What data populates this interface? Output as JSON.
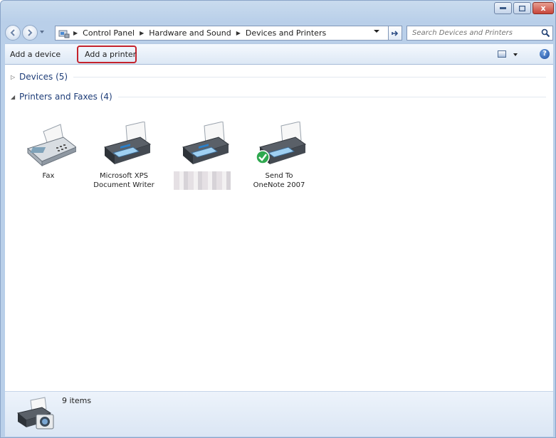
{
  "window": {
    "caption": {
      "minimize_symbol": "–",
      "maximize_symbol": "□",
      "close_symbol": "x"
    }
  },
  "address_bar": {
    "breadcrumbs": [
      "Control Panel",
      "Hardware and Sound",
      "Devices and Printers"
    ]
  },
  "search": {
    "placeholder": "Search Devices and Printers"
  },
  "toolbar": {
    "add_device_label": "Add a device",
    "add_printer_label": "Add a printer",
    "highlight_color": "#c4222c"
  },
  "groups": {
    "devices": {
      "label": "Devices (5)",
      "expanded": false
    },
    "printers": {
      "label": "Printers and Faxes (4)",
      "expanded": true
    }
  },
  "printers": [
    {
      "name_line1": "Fax",
      "name_line2": "",
      "icon": "fax-icon"
    },
    {
      "name_line1": "Microsoft XPS",
      "name_line2": "Document Writer",
      "icon": "printer-icon"
    },
    {
      "name_line1": "",
      "name_line2": "",
      "icon": "printer-icon",
      "redacted": true
    },
    {
      "name_line1": "Send To",
      "name_line2": "OneNote 2007",
      "icon": "printer-icon",
      "default": true
    }
  ],
  "details": {
    "count_text": "9 items"
  },
  "colors": {
    "accent": "#1e3d78",
    "frame": "#b9cfe9"
  }
}
